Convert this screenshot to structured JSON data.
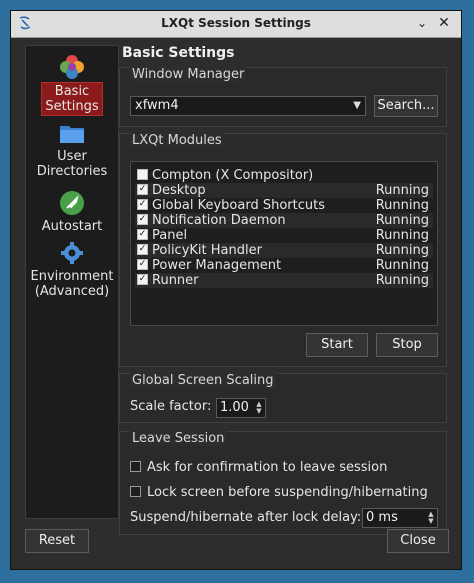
{
  "window": {
    "title": "LXQt Session Settings"
  },
  "sidebar": {
    "items": [
      {
        "label_lines": [
          "Basic",
          "Settings"
        ],
        "icon": "basic-settings-icon",
        "selected": true
      },
      {
        "label_lines": [
          "User",
          "Directories"
        ],
        "icon": "folder-icon",
        "selected": false
      },
      {
        "label_lines": [
          "Autostart"
        ],
        "icon": "rocket-icon",
        "selected": false
      },
      {
        "label_lines": [
          "Environment",
          "(Advanced)"
        ],
        "icon": "gear-icon",
        "selected": false
      }
    ]
  },
  "main": {
    "title": "Basic Settings",
    "window_manager": {
      "group_title": "Window Manager",
      "value": "xfwm4",
      "search_label": "Search..."
    },
    "modules": {
      "group_title": "LXQt Modules",
      "rows": [
        {
          "name": "Compton (X Compositor)",
          "checked": false,
          "status": ""
        },
        {
          "name": "Desktop",
          "checked": true,
          "status": "Running"
        },
        {
          "name": "Global Keyboard Shortcuts",
          "checked": true,
          "status": "Running"
        },
        {
          "name": "Notification Daemon",
          "checked": true,
          "status": "Running"
        },
        {
          "name": "Panel",
          "checked": true,
          "status": "Running"
        },
        {
          "name": "PolicyKit Handler",
          "checked": true,
          "status": "Running"
        },
        {
          "name": "Power Management",
          "checked": true,
          "status": "Running"
        },
        {
          "name": "Runner",
          "checked": true,
          "status": "Running"
        }
      ],
      "start_label": "Start",
      "stop_label": "Stop"
    },
    "scaling": {
      "group_title": "Global Screen Scaling",
      "scale_label": "Scale factor:",
      "scale_value": "1.00"
    },
    "leave": {
      "group_title": "Leave Session",
      "confirm_label": "Ask for confirmation to leave session",
      "lock_label": "Lock screen before suspending/hibernating",
      "delay_label": "Suspend/hibernate after lock delay:",
      "delay_value": "0 ms"
    }
  },
  "footer": {
    "reset_label": "Reset",
    "close_label": "Close"
  },
  "colors": {
    "desktop": "#2f6f9e",
    "selected": "#8b1a1a",
    "window_bg": "#2d2d2d"
  }
}
